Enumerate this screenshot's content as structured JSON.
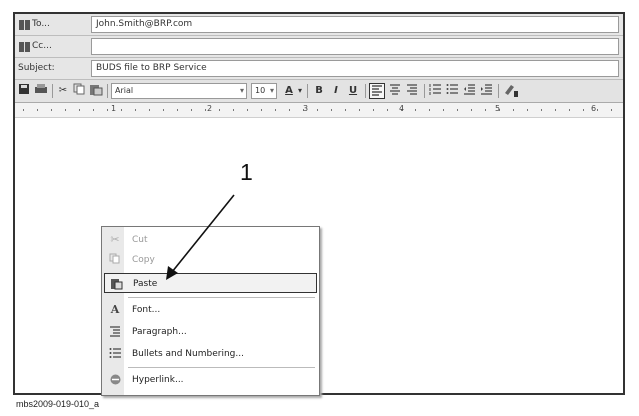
{
  "header": {
    "to_label": "To...",
    "to_value": "John.Smith@BRP.com",
    "cc_label": "Cc...",
    "cc_value": "",
    "subject_label": "Subject:",
    "subject_value": "BUDS file to BRP Service"
  },
  "toolbar": {
    "font_name": "Arial",
    "font_size": "10",
    "font_color_glyph": "A",
    "bold": "B",
    "italic": "I",
    "underline": "U",
    "icons": [
      "save-icon",
      "print-icon",
      "cut-icon",
      "copy-icon",
      "paste-icon",
      "align-left-icon",
      "align-center-icon",
      "align-right-icon",
      "numbered-list-icon",
      "bulleted-list-icon",
      "decrease-indent-icon",
      "increase-indent-icon",
      "highlight-icon"
    ]
  },
  "ruler": {
    "numbers": [
      "1",
      "2",
      "3",
      "4",
      "5",
      "6"
    ]
  },
  "callout": {
    "number": "1"
  },
  "context_menu": {
    "items": [
      {
        "label": "Cut",
        "icon": "scissors-icon",
        "enabled": false
      },
      {
        "label": "Copy",
        "icon": "copy-icon",
        "enabled": false
      },
      {
        "label": "Paste",
        "icon": "clipboard-icon",
        "enabled": true,
        "selected": true
      },
      {
        "label": "Font...",
        "icon": "font-icon",
        "enabled": true
      },
      {
        "label": "Paragraph...",
        "icon": "paragraph-icon",
        "enabled": true
      },
      {
        "label": "Bullets and Numbering...",
        "icon": "bullets-icon",
        "enabled": true
      },
      {
        "label": "Hyperlink...",
        "icon": "hyperlink-icon",
        "enabled": true
      }
    ]
  },
  "caption": "mbs2009-019-010_a"
}
